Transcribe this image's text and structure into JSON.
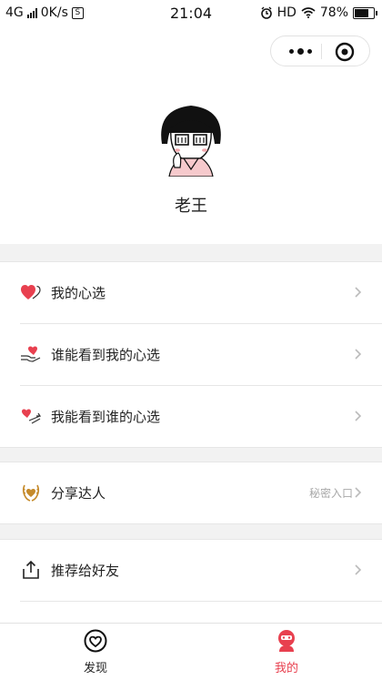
{
  "status_bar": {
    "network": "4G",
    "speed": "0K/s",
    "time": "21:04",
    "hd": "HD",
    "battery": "78%",
    "battery_level": 0.78
  },
  "profile": {
    "name": "老王"
  },
  "menu_groups": [
    {
      "items": [
        {
          "label": "我的心选",
          "icon": "heart-pair-icon"
        },
        {
          "label": "谁能看到我的心选",
          "icon": "heart-hand-icon"
        },
        {
          "label": "我能看到谁的心选",
          "icon": "heart-arrow-icon"
        }
      ]
    },
    {
      "items": [
        {
          "label": "分享达人",
          "icon": "laurel-heart-icon",
          "side_text": "秘密入口"
        }
      ]
    },
    {
      "items": [
        {
          "label": "推荐给好友",
          "icon": "share-icon"
        }
      ]
    }
  ],
  "tabbar": {
    "tabs": [
      {
        "label": "发现",
        "icon": "heart-circle-icon",
        "active": false
      },
      {
        "label": "我的",
        "icon": "profile-icon",
        "active": true
      }
    ]
  },
  "colors": {
    "accent": "#e8404f",
    "heart": "#e8404f",
    "gold": "#c58a2a",
    "text": "#222222",
    "muted": "#a8a8a8",
    "page_bg": "#f2f2f2"
  }
}
